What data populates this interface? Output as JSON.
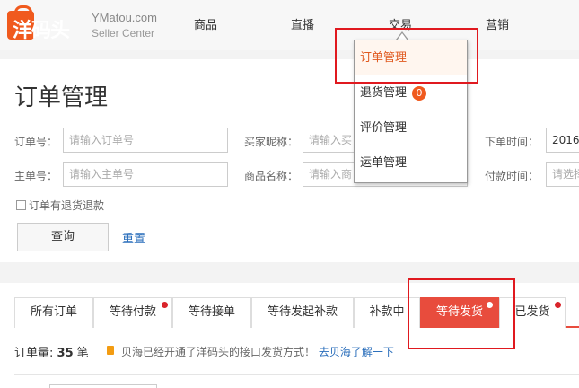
{
  "header": {
    "logo_text": "洋码头",
    "brand": "YMatou.com",
    "brand_sub": "Seller Center",
    "nav": [
      "商品",
      "直播",
      "交易",
      "营销"
    ]
  },
  "page": {
    "title": "订单管理"
  },
  "filters": {
    "order_no_label": "订单号：",
    "order_no_placeholder": "请输入订单号",
    "buyer_label": "买家昵称：",
    "buyer_placeholder": "请输入买",
    "order_time_label": "下单时间：",
    "order_time_value": "2016",
    "master_no_label": "主单号：",
    "master_no_placeholder": "请输入主单号",
    "product_label": "商品名称：",
    "product_placeholder": "请输入商",
    "pay_time_label": "付款时间：",
    "pay_time_placeholder": "请选择",
    "refund_checkbox_label": "订单有退货退款",
    "query_button": "查询",
    "reset_link": "重置"
  },
  "dropdown": {
    "items": [
      {
        "label": "订单管理",
        "badge": ""
      },
      {
        "label": "退货管理",
        "badge": "0"
      },
      {
        "label": "评价管理",
        "badge": ""
      },
      {
        "label": "运单管理",
        "badge": ""
      }
    ]
  },
  "tabs": [
    {
      "label": "所有订单",
      "dot": false
    },
    {
      "label": "等待付款",
      "dot": true
    },
    {
      "label": "等待接单",
      "dot": false
    },
    {
      "label": "等待发起补款",
      "dot": false
    },
    {
      "label": "补款中",
      "dot": false
    },
    {
      "label": "等待发货",
      "dot": true
    },
    {
      "label": "已发货",
      "dot": true
    }
  ],
  "summary": {
    "count_label": "订单量:",
    "count_value": "35",
    "count_unit": "笔",
    "notice_text": "贝海已经开通了洋码头的接口发货方式！",
    "learn_link": "去贝海了解一下"
  },
  "colors": {
    "accent": "#e84c3d",
    "brand": "#f05a1e",
    "link": "#2a6ebb",
    "annotation": "#e0191f"
  }
}
